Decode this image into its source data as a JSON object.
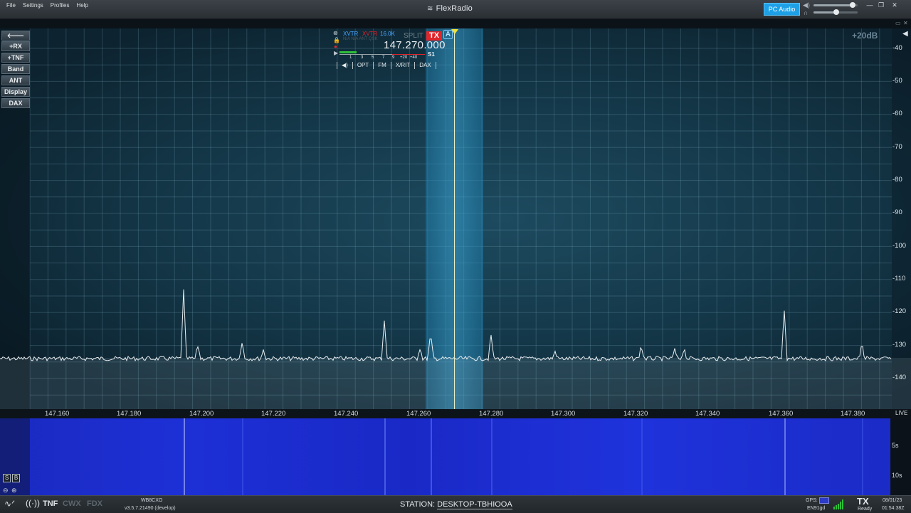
{
  "menu": [
    "File",
    "Settings",
    "Profiles",
    "Help"
  ],
  "brand": "FlexRadio",
  "pc_audio_label": "PC Audio",
  "pc_volume": 0.88,
  "headphone_volume": 0.52,
  "left_buttons": [
    "+RX",
    "+TNF",
    "Band",
    "ANT",
    "Display",
    "DAX"
  ],
  "db_ref": "+20dB",
  "db_scale": [
    "-40",
    "-50",
    "-60",
    "-70",
    "-80",
    "-90",
    "-100",
    "-110",
    "-120",
    "-130",
    "-140"
  ],
  "freq_axis": [
    "147.160",
    "147.180",
    "147.200",
    "147.220",
    "147.240",
    "147.260",
    "147.280",
    "147.300",
    "147.320",
    "147.340",
    "147.360",
    "147.380"
  ],
  "live_label": "LIVE",
  "waterfall_times": [
    "5s",
    "10s"
  ],
  "wf_buttons": [
    "S",
    "B"
  ],
  "slice": {
    "xvtr1": "XVTR",
    "xvtr2": "XVTR",
    "filter": "16.0K",
    "rx_ant_line": "N/A  N/A  ANT  QSK",
    "split": "SPLIT",
    "tx": "TX",
    "letter": "A",
    "frequency": "147.270.000",
    "s_units": [
      "1",
      "3",
      "5",
      "7",
      "9",
      "+20",
      "+40"
    ],
    "s_reading": "S1",
    "tabs": [
      "OPT",
      "FM",
      "X/RIT",
      "DAX"
    ]
  },
  "status": {
    "tnf": "TNF",
    "cwx": "CWX",
    "fdx": "FDX",
    "callsign": "WB8CXO",
    "version": "v3.5.7.21490 (develop)",
    "station_label": "STATION:",
    "station_value": "DESKTOP-TBHIOOA",
    "gps_label": "GPS:",
    "grid": "EN91gd",
    "tx": "TX",
    "tx_state": "Ready",
    "date": "08/01/23",
    "time": "01:54:38Z"
  },
  "colors": {
    "accent": "#1ea0e6",
    "tx_red": "#e0252b",
    "waterfall_blue": "#1d30d6",
    "tune_marker": "#f1e23b"
  }
}
